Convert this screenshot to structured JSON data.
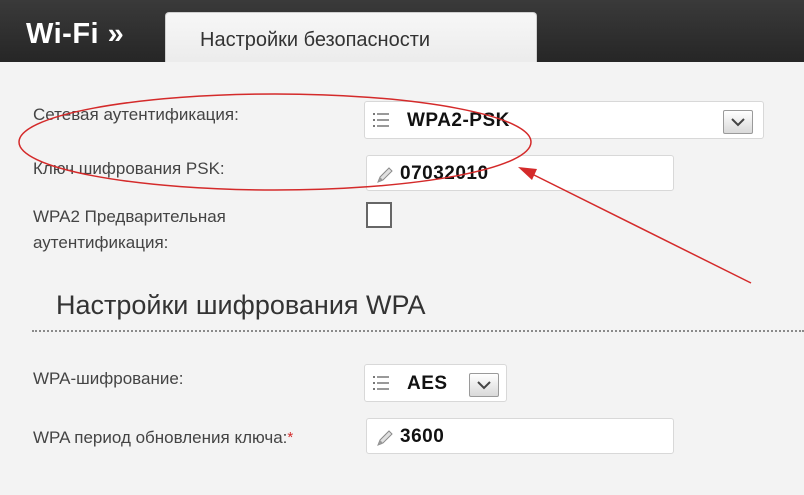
{
  "header": {
    "brand": "Wi-Fi »",
    "tab_label": "Настройки безопасности"
  },
  "auth": {
    "label": "Сетевая аутентификация:",
    "value": "WPA2-PSK"
  },
  "psk": {
    "label": "Ключ шифрования PSK:",
    "value": "07032010"
  },
  "preauth": {
    "label_line1": "WPA2 Предварительная",
    "label_line2": "аутентификация:",
    "checked": false
  },
  "wpa_section": {
    "title": "Настройки шифрования WPA"
  },
  "wpa_cipher": {
    "label": "WPA-шифрование:",
    "value": "AES"
  },
  "rekey": {
    "label": "WPA период обновления ключа:",
    "required_mark": "*",
    "value": "3600"
  },
  "colors": {
    "header_bg": "#2b2b2b",
    "annotation": "#d42a2a",
    "required": "#d42a2a"
  }
}
